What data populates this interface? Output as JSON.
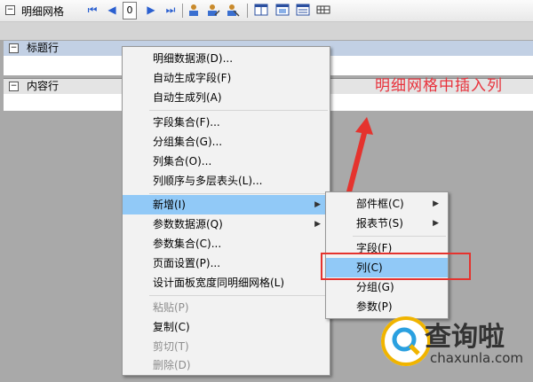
{
  "toolbar": {
    "title": "明细网格",
    "page_value": "0",
    "collapse_glyph": "−"
  },
  "bands": [
    {
      "label": "标题行",
      "glyph": "−"
    },
    {
      "label": "内容行",
      "glyph": "−"
    }
  ],
  "context_menu": {
    "items": [
      {
        "label": "明细数据源(D)...",
        "disabled": false
      },
      {
        "label": "自动生成字段(F)",
        "disabled": false
      },
      {
        "label": "自动生成列(A)",
        "disabled": false
      },
      {
        "label": "字段集合(F)...",
        "disabled": false
      },
      {
        "label": "分组集合(G)...",
        "disabled": false
      },
      {
        "label": "列集合(O)...",
        "disabled": false
      },
      {
        "label": "列顺序与多层表头(L)...",
        "disabled": false
      },
      {
        "label": "新增(I)",
        "disabled": false,
        "submenu": true,
        "highlighted": true
      },
      {
        "label": "参数数据源(Q)",
        "disabled": false,
        "submenu": true
      },
      {
        "label": "参数集合(C)...",
        "disabled": false
      },
      {
        "label": "页面设置(P)...",
        "disabled": false
      },
      {
        "label": "设计面板宽度同明细网格(L)",
        "disabled": false
      },
      {
        "label": "粘贴(P)",
        "disabled": true
      },
      {
        "label": "复制(C)",
        "disabled": false
      },
      {
        "label": "剪切(T)",
        "disabled": true
      },
      {
        "label": "删除(D)",
        "disabled": true
      }
    ]
  },
  "submenu": {
    "items": [
      {
        "label": "部件框(C)",
        "submenu": true
      },
      {
        "label": "报表节(S)",
        "submenu": true
      },
      {
        "label": "字段(F)"
      },
      {
        "label": "列(C)",
        "highlighted": true
      },
      {
        "label": "分组(G)"
      },
      {
        "label": "参数(P)"
      }
    ]
  },
  "annotation": "明细网格中插入列",
  "watermark": {
    "main": "查询啦",
    "sub": "chaxunla.com"
  },
  "colors": {
    "highlight": "#91c9f7",
    "annotation": "#e8323c",
    "toolbar_icons": "#2a5fd0"
  }
}
